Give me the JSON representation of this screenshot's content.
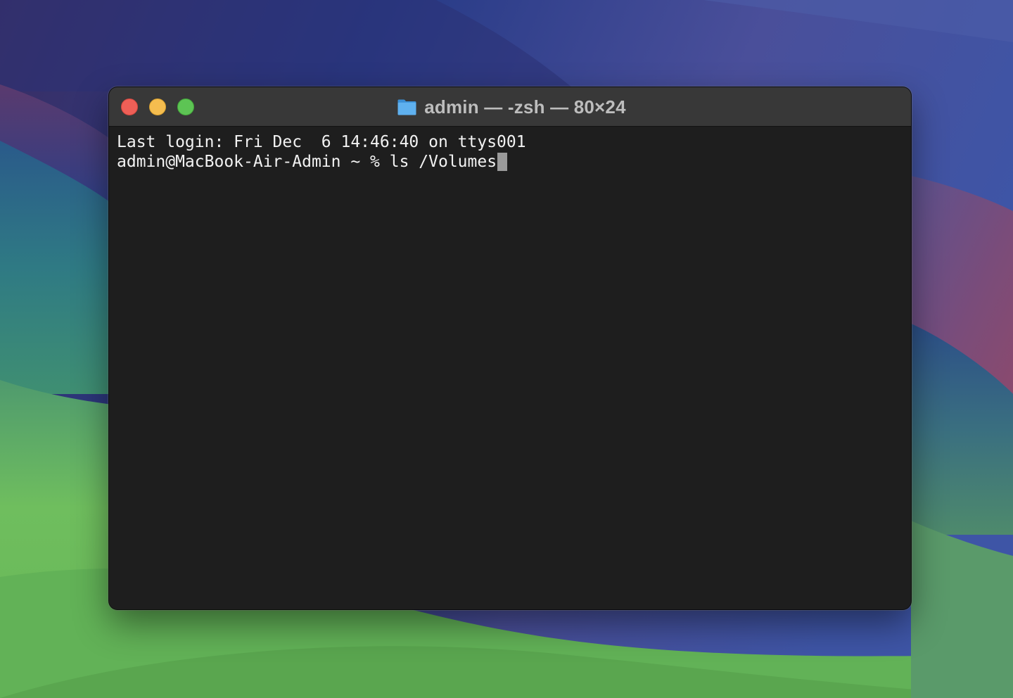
{
  "window": {
    "title": "admin — -zsh — 80×24",
    "folder_icon": "folder-icon",
    "buttons": {
      "close": "close-button",
      "minimize": "minimize-button",
      "zoom": "zoom-button"
    }
  },
  "terminal": {
    "login_line": "Last login: Fri Dec  6 14:46:40 on ttys001",
    "prompt": "admin@MacBook-Air-Admin ~ % ",
    "command": "ls /Volumes"
  },
  "colors": {
    "close": "#ee5f57",
    "minimize": "#f5bd4f",
    "zoom": "#5dc454",
    "terminal_bg": "#1e1e1e",
    "terminal_text": "#f2f2f2",
    "titlebar_bg": "#383838"
  }
}
